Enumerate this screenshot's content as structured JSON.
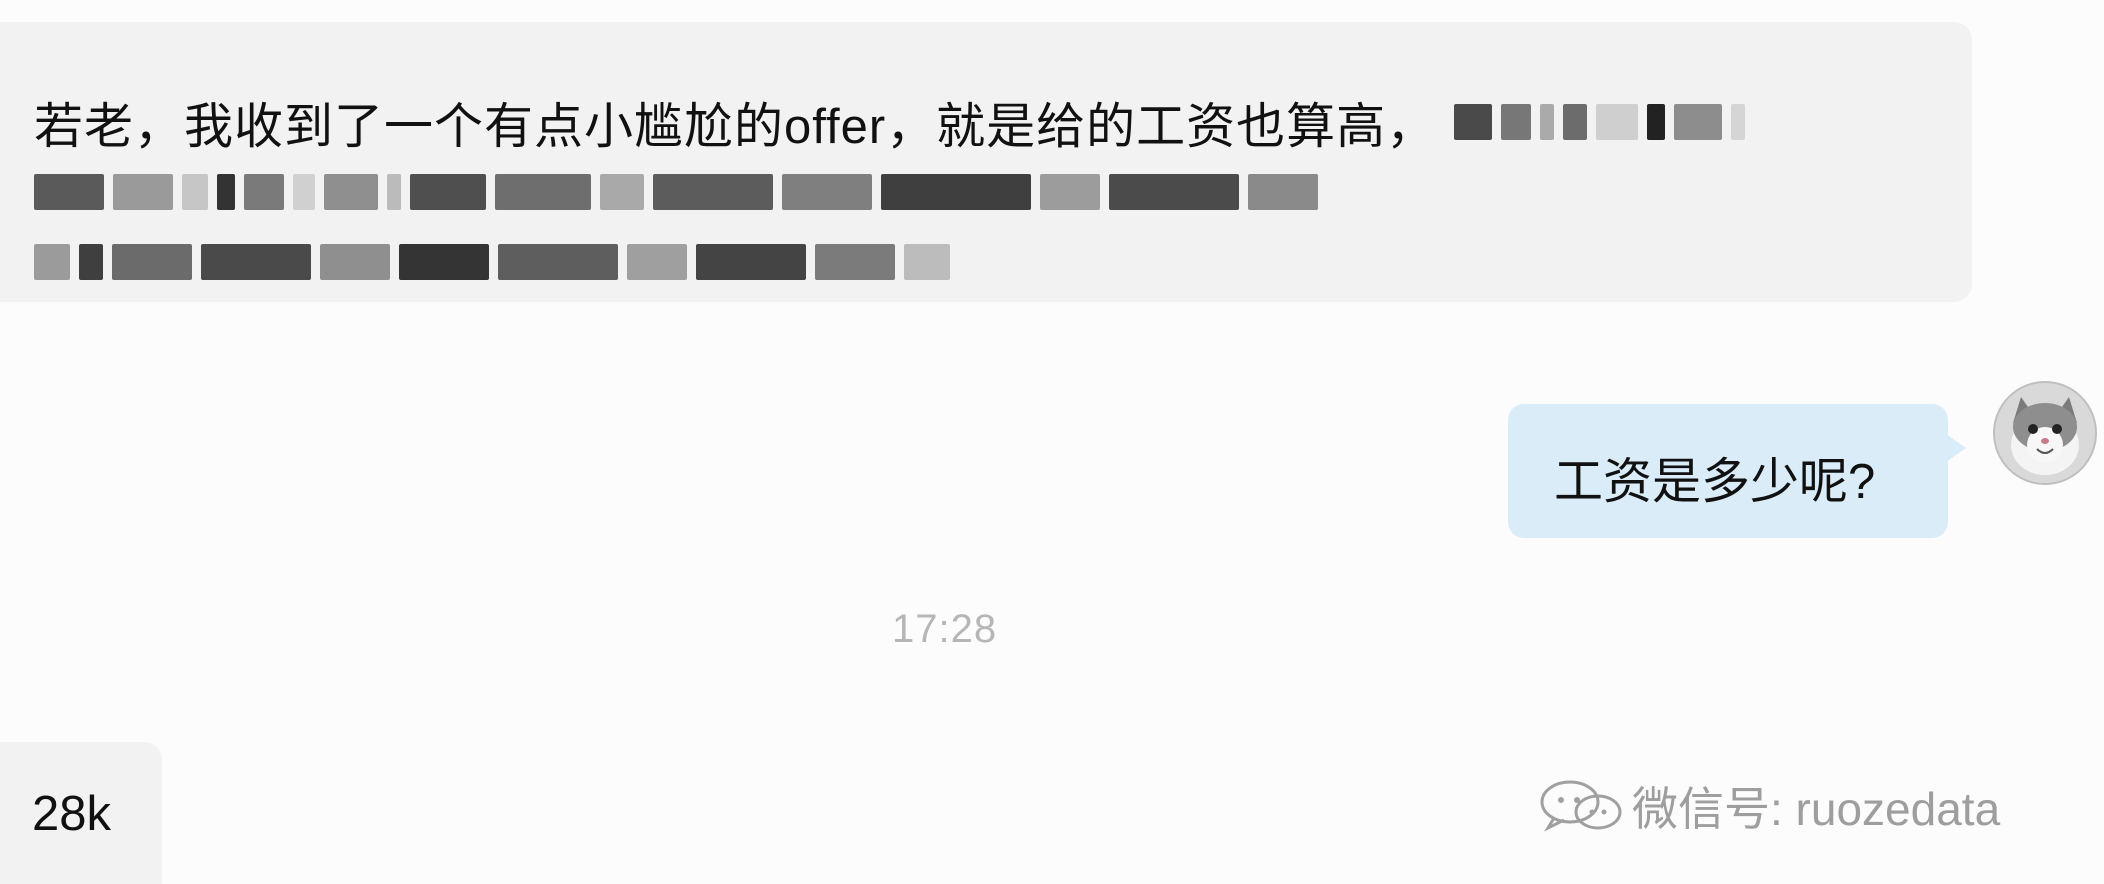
{
  "messages": {
    "incoming_first": {
      "text": "若老，我收到了一个有点小尴尬的offer，就是给的工资也算高，"
    },
    "outgoing_question": {
      "text": "工资是多少呢?"
    },
    "incoming_reply": {
      "text": "28k"
    }
  },
  "timestamp": "17:28",
  "watermark": {
    "label": "微信号: ruozedata",
    "icon": "wechat-icon"
  },
  "avatar": {
    "icon": "cat-avatar"
  },
  "colors": {
    "background": "#fdfcfd",
    "incoming_bubble": "#f2f2f2",
    "outgoing_bubble": "#d9ecf8",
    "timestamp": "#b6b6b6",
    "watermark": "#9e9e9e"
  }
}
